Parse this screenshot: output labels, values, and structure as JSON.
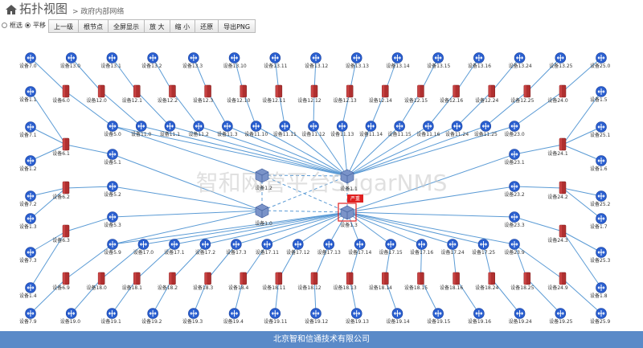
{
  "header": {
    "title": "拓扑视图",
    "crumb": "> 政府内部网络"
  },
  "toolbar": {
    "radio_select": "框选",
    "radio_pan": "平移",
    "buttons": [
      "上一级",
      "根节点",
      "全屏显示",
      "放 大",
      "缩 小",
      "还原",
      "导出PNG"
    ]
  },
  "watermark": "智和网管平台SugarNMS",
  "alarm_badge": "严重",
  "footer": "北京智和信通技术有限公司",
  "colors": {
    "link": "#5b9bd5",
    "switch": "#2a5fd0",
    "firewall": "#b03030",
    "footer": "#5a8ac8",
    "alarm": "#e02020"
  },
  "core_nodes": [
    {
      "id": "c12",
      "label": "设备1.2",
      "type": "core"
    },
    {
      "id": "c11",
      "label": "设备1.1",
      "type": "core"
    },
    {
      "id": "c10",
      "label": "设备1.0",
      "type": "core"
    },
    {
      "id": "c13",
      "label": "设备1.3",
      "type": "core",
      "alarm": true
    }
  ],
  "rows": {
    "top": [
      "设备7.0",
      "设备13.0",
      "设备13.1",
      "设备13.2",
      "设备13.3",
      "设备13.10",
      "设备13.11",
      "设备13.12",
      "设备13.13",
      "设备13.14",
      "设备13.15",
      "设备13.16",
      "设备13.24",
      "设备13.25",
      "设备25.0"
    ],
    "fw_top": [
      "设备6.0",
      "设备12.0",
      "设备12.1",
      "设备12.2",
      "设备12.3",
      "设备12.10",
      "设备12.11",
      "设备12.12",
      "设备12.13",
      "设备12.14",
      "设备12.15",
      "设备12.16",
      "设备12.24",
      "设备12.25",
      "设备24.0"
    ],
    "sw_top": [
      "设备5.0",
      "设备11.0",
      "设备11.1",
      "设备11.2",
      "设备11.3",
      "设备11.10",
      "设备11.11",
      "设备11.12",
      "设备11.13",
      "设备11.14",
      "设备11.15",
      "设备11.16",
      "设备11.24",
      "设备11.25",
      "设备23.0"
    ],
    "sw_bottom": [
      "设备5.9",
      "设备17.0",
      "设备17.1",
      "设备17.2",
      "设备17.3",
      "设备17.11",
      "设备17.12",
      "设备17.13",
      "设备17.14",
      "设备17.15",
      "设备17.16",
      "设备17.24",
      "设备17.25",
      "设备23.9"
    ],
    "fw_bottom": [
      "设备6.9",
      "设备18.0",
      "设备18.1",
      "设备18.2",
      "设备18.3",
      "设备18.4",
      "设备18.11",
      "设备18.12",
      "设备18.13",
      "设备18.14",
      "设备18.15",
      "设备18.16",
      "设备18.24",
      "设备18.25",
      "设备24.9"
    ],
    "bottom": [
      "设备7.9",
      "设备19.0",
      "设备19.1",
      "设备19.2",
      "设备19.3",
      "设备19.4",
      "设备19.11",
      "设备19.12",
      "设备19.13",
      "设备19.14",
      "设备19.15",
      "设备19.16",
      "设备19.24",
      "设备19.25",
      "设备25.9"
    ],
    "left_far": [
      "设备1.1",
      "设备7.1",
      "设备1.2",
      "设备7.2",
      "设备1.3",
      "设备7.3",
      "设备1.4"
    ],
    "left_fw": [
      "设备6.1",
      "设备6.2",
      "设备6.3"
    ],
    "left_sw": [
      "设备5.1",
      "设备5.2",
      "设备5.3"
    ],
    "right_far": [
      "设备1.5",
      "设备25.1",
      "设备1.6",
      "设备25.2",
      "设备1.7",
      "设备25.3",
      "设备1.8"
    ],
    "right_fw": [
      "设备24.1",
      "设备24.2",
      "设备24.3"
    ],
    "right_sw": [
      "设备23.1",
      "设备23.2",
      "设备23.3"
    ]
  }
}
